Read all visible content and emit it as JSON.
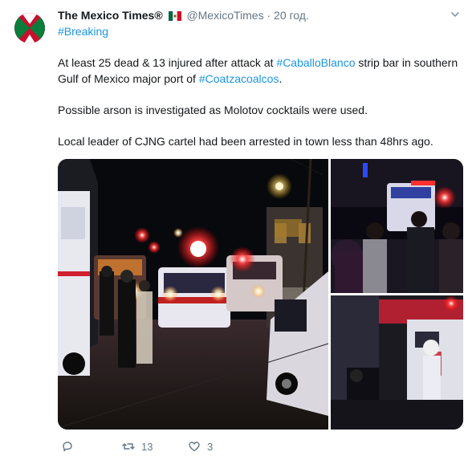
{
  "tweet": {
    "author_name": "The Mexico Times®",
    "handle": "@MexicoTimes",
    "separator": "·",
    "time": "20 год.",
    "hashtag": "#Breaking",
    "line1_pre": "At least 25 dead & 13 injured after attack at ",
    "line1_tag": "#CaballoBlanco",
    "line1_mid": " strip bar in southern Gulf of Mexico major port of ",
    "line1_tag2": "#Coatzacoalcos",
    "line1_end": ".",
    "para2": "Possible arson is investigated as Molotov cocktails were used.",
    "para3": "Local leader of CJNG cartel had been arrested in town less than 48hrs ago."
  },
  "actions": {
    "reply_count": "",
    "retweet_count": "13",
    "like_count": "3"
  },
  "icons": {
    "avatar": "mexico-times-logo",
    "flag": "mexico-flag",
    "caret": "chevron-down-icon",
    "reply": "reply-icon",
    "retweet": "retweet-icon",
    "like": "heart-icon"
  },
  "colors": {
    "link": "#1b95e0",
    "muted": "#657786",
    "avatar_red": "#c8102e",
    "avatar_green": "#0a7d3b"
  }
}
